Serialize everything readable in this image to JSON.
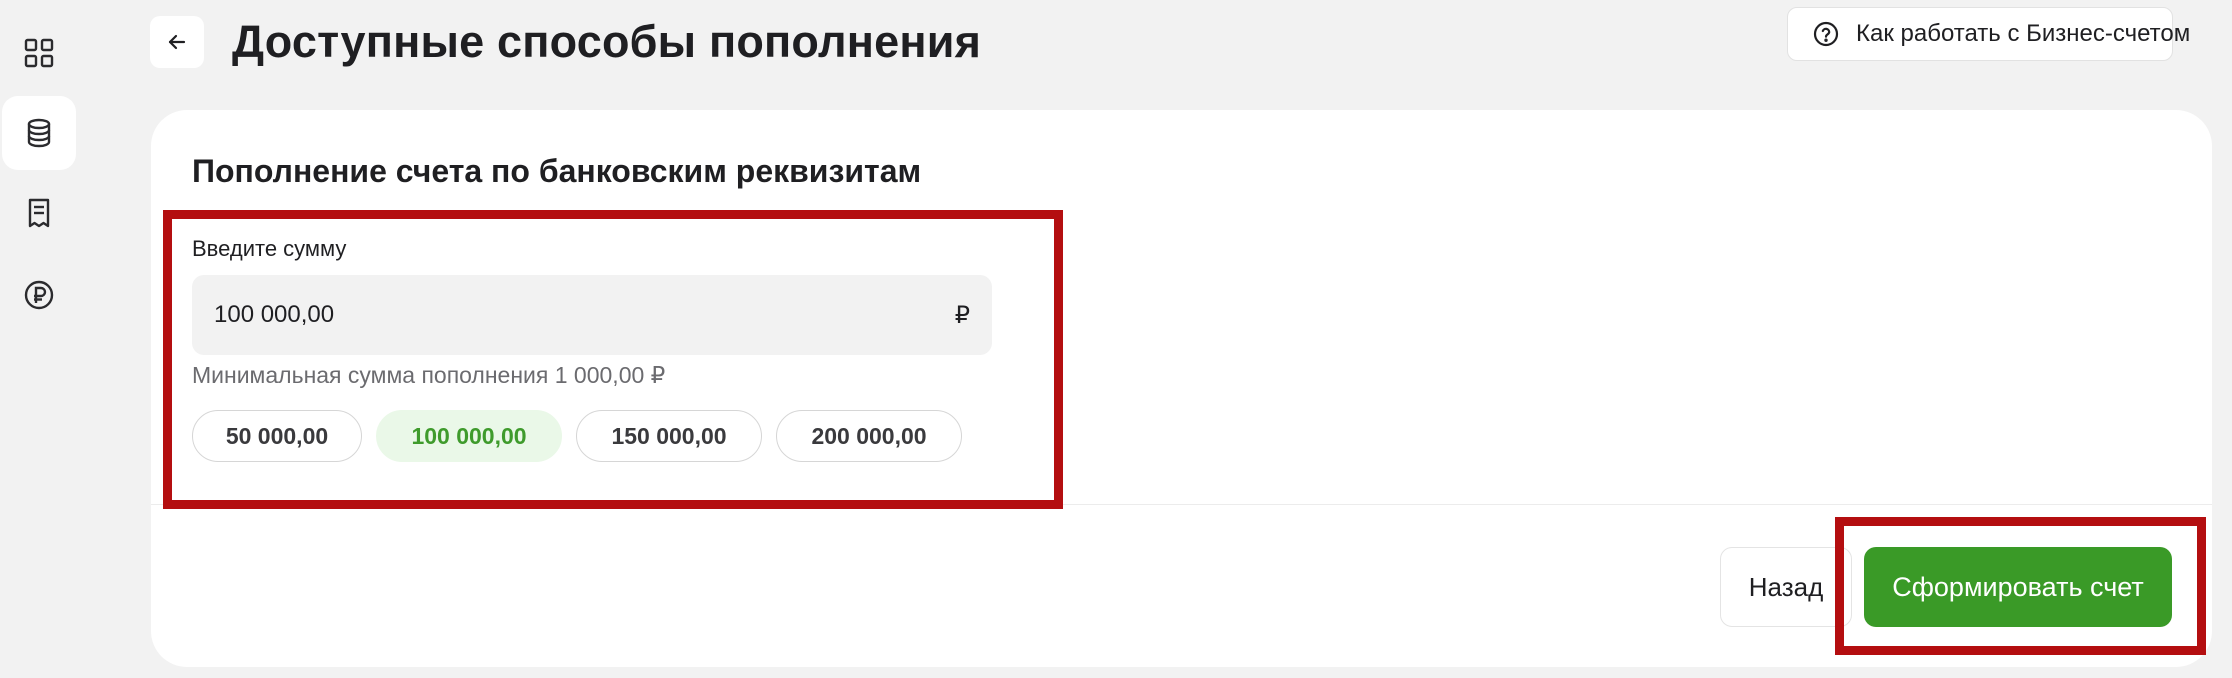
{
  "header": {
    "title": "Доступные способы пополнения",
    "help_label": "Как работать с Бизнес-счетом"
  },
  "sidebar": {
    "items": [
      {
        "icon": "grid-icon",
        "active": false
      },
      {
        "icon": "database-icon",
        "active": true
      },
      {
        "icon": "receipt-icon",
        "active": false
      },
      {
        "icon": "ruble-icon",
        "active": false
      }
    ]
  },
  "card": {
    "title": "Пополнение счета по банковским реквизитам",
    "amount_label": "Введите сумму",
    "amount_value": "100 000,00",
    "currency": "₽",
    "hint": "Минимальная сумма пополнения 1 000,00 ₽",
    "presets": [
      {
        "label": "50 000,00",
        "selected": false
      },
      {
        "label": "100 000,00",
        "selected": true
      },
      {
        "label": "150 000,00",
        "selected": false
      },
      {
        "label": "200 000,00",
        "selected": false
      }
    ],
    "back_label": "Назад",
    "submit_label": "Сформировать счет"
  },
  "colors": {
    "accent": "#3a9a27",
    "selected_chip_bg": "#eaf8e8",
    "selected_chip_text": "#3f9b2c",
    "annotation": "#b40e10",
    "page_bg": "#f2f2f2"
  }
}
